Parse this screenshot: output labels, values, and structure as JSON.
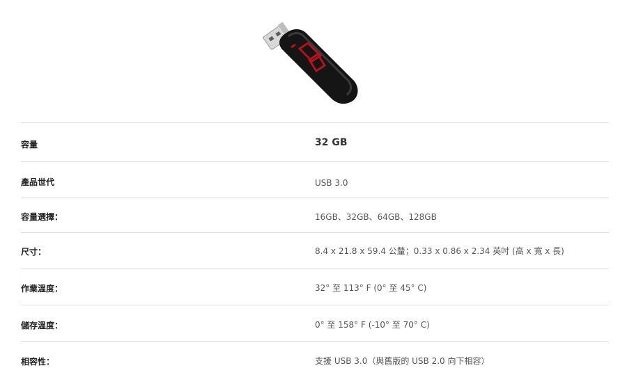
{
  "product": {
    "image_alt": "SanDisk Cruzer Glide USB flash drive",
    "image_icon": "usb-flash-drive-image",
    "accent_color": "#b5121b"
  },
  "specs": [
    {
      "label": "容量",
      "value": "32 GB"
    },
    {
      "label": "產品世代",
      "value": "USB 3.0"
    },
    {
      "label": "容量選擇：",
      "value": "16GB、32GB、64GB、128GB"
    },
    {
      "label": "尺寸：",
      "value": "8.4 x 21.8 x 59.4 公釐；0.33 x 0.86 x 2.34 英吋 (高 x 寬 x 長)"
    },
    {
      "label": "作業溫度：",
      "value": "32° 至 113° F (0° 至 45° C)"
    },
    {
      "label": "儲存溫度：",
      "value": "0° 至 158° F (-10° 至 70° C)"
    },
    {
      "label": "相容性：",
      "value": "支援 USB 3.0（與舊版的 USB 2.0 向下相容）"
    }
  ]
}
